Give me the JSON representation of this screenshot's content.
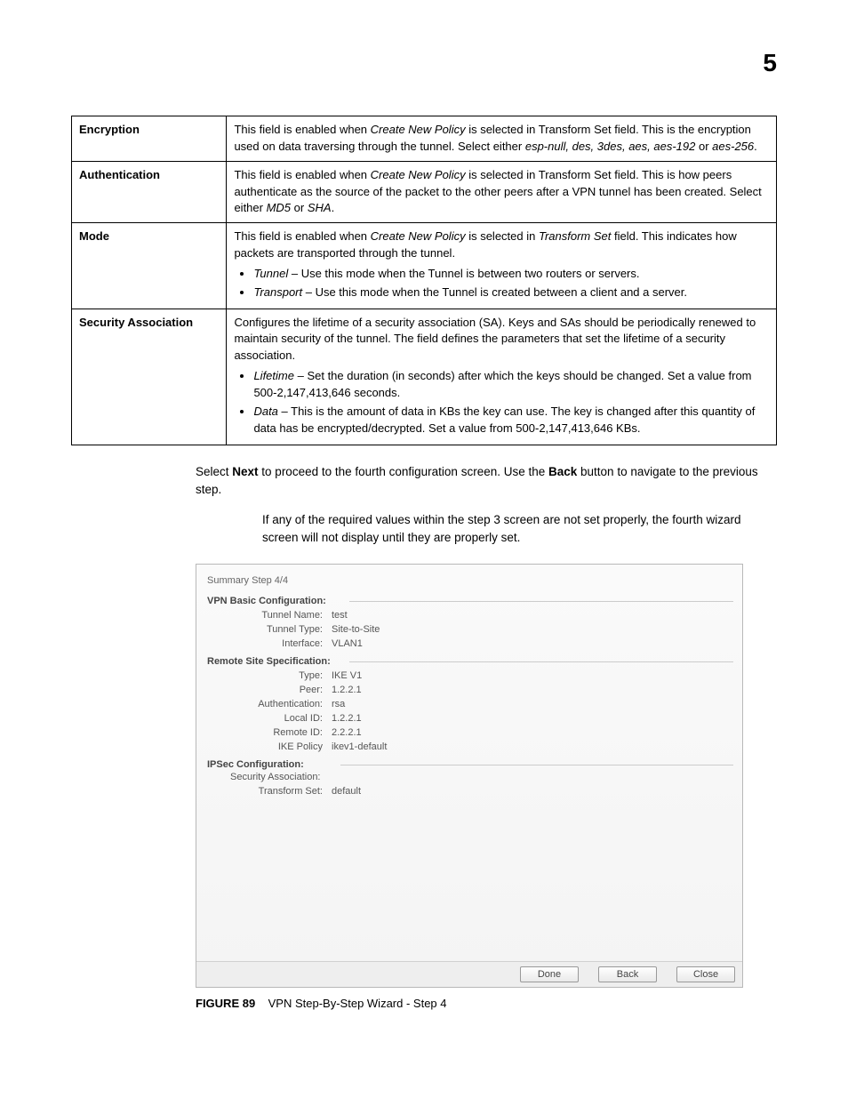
{
  "page_number": "5",
  "table": {
    "rows": [
      {
        "label": "Encryption",
        "text_parts": [
          "This field is enabled when ",
          {
            "i": "Create New Policy"
          },
          " is selected in Transform Set field. This is the encryption used on data traversing through the tunnel. Select either ",
          {
            "i": "esp-null, des, 3des, aes, aes-192"
          },
          " or ",
          {
            "i": "aes-256"
          },
          "."
        ]
      },
      {
        "label": "Authentication",
        "text_parts": [
          "This field is enabled when ",
          {
            "i": "Create New Policy"
          },
          " is selected in Transform Set field. This is how peers authenticate as the source of the packet to the other peers after a VPN tunnel has been created. Select either ",
          {
            "i": "MD5"
          },
          " or ",
          {
            "i": "SHA"
          },
          "."
        ]
      },
      {
        "label": "Mode",
        "text_parts": [
          "This field is enabled when ",
          {
            "i": "Create New Policy"
          },
          " is selected in ",
          {
            "i": "Transform Set"
          },
          " field. This indicates how packets are transported through the tunnel."
        ],
        "bullets": [
          [
            {
              "i": "Tunnel"
            },
            " – Use this mode when the Tunnel is between two routers or servers."
          ],
          [
            {
              "i": "Transport"
            },
            " – Use this mode when the Tunnel is created between a client and a server."
          ]
        ]
      },
      {
        "label": "Security Association",
        "text_parts": [
          "Configures the lifetime of a security association (SA). Keys and SAs should be periodically renewed to maintain security of the tunnel. The field defines the parameters that set the lifetime of a security association."
        ],
        "bullets": [
          [
            {
              "i": "Lifetime"
            },
            " – Set the duration (in seconds) after which the keys should be changed. Set a value from 500-2,147,413,646 seconds."
          ],
          [
            {
              "i": "Data"
            },
            " – This is the amount of data in KBs the key can use. The key is changed after this quantity of data has be encrypted/decrypted. Set a value from 500-2,147,413,646 KBs."
          ]
        ]
      }
    ]
  },
  "para1": {
    "pre": "Select ",
    "b1": "Next",
    "mid": " to proceed to the fourth configuration screen. Use the ",
    "b2": "Back",
    "post": " button to navigate to the previous step."
  },
  "para2": "If any of the required values within the step 3 screen are not set properly, the fourth wizard screen will not display until they are properly set.",
  "screenshot": {
    "step_title": "Summary  Step 4/4",
    "sections": [
      {
        "title": "VPN Basic Configuration:",
        "rows": [
          {
            "k": "Tunnel Name:",
            "v": "test"
          },
          {
            "k": "Tunnel Type:",
            "v": "Site-to-Site"
          },
          {
            "k": "Interface:",
            "v": "VLAN1"
          }
        ]
      },
      {
        "title": "Remote Site Specification:",
        "rows": [
          {
            "k": "Type:",
            "v": "IKE V1"
          },
          {
            "k": "Peer:",
            "v": "1.2.2.1"
          },
          {
            "k": "Authentication:",
            "v": "rsa"
          },
          {
            "k": "Local ID:",
            "v": "1.2.2.1"
          },
          {
            "k": "Remote ID:",
            "v": "2.2.2.1"
          },
          {
            "k": "IKE Policy",
            "v": "ikev1-default"
          }
        ]
      },
      {
        "title": "IPSec Configuration:",
        "subline": "Security Association:",
        "rows": [
          {
            "k": "Transform Set:",
            "v": "default"
          }
        ]
      }
    ],
    "buttons": {
      "done": "Done",
      "back": "Back",
      "close": "Close"
    }
  },
  "caption": {
    "fig": "FIGURE 89",
    "text": "VPN Step-By-Step Wizard - Step 4"
  }
}
